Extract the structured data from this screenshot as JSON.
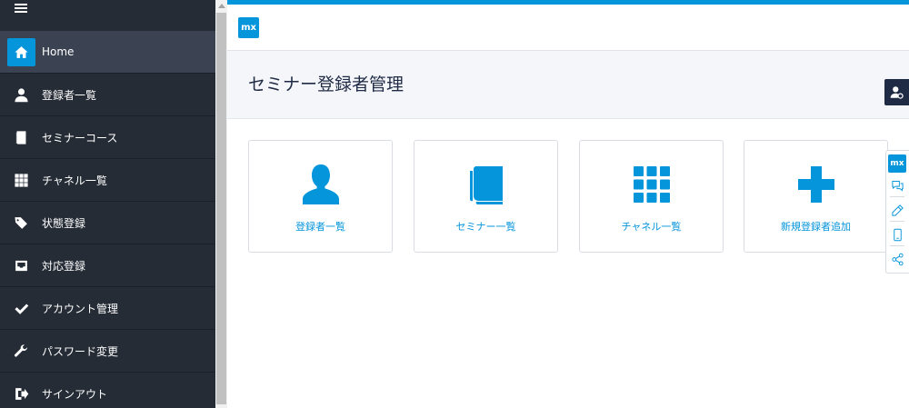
{
  "sidebar": {
    "items": [
      {
        "label": "Home",
        "icon": "home-icon"
      },
      {
        "label": "登録者一覧",
        "icon": "user-icon"
      },
      {
        "label": "セミナーコース",
        "icon": "book-icon"
      },
      {
        "label": "チャネル一覧",
        "icon": "grid-icon"
      },
      {
        "label": "状態登録",
        "icon": "tags-icon"
      },
      {
        "label": "対応登録",
        "icon": "inbox-icon"
      },
      {
        "label": "アカウント管理",
        "icon": "check-icon"
      },
      {
        "label": "パスワード変更",
        "icon": "wrench-icon"
      },
      {
        "label": "サインアウト",
        "icon": "sign-out-icon"
      }
    ]
  },
  "topbar": {
    "logo_text": "mx"
  },
  "page": {
    "title": "セミナー登録者管理"
  },
  "tiles": [
    {
      "label": "登録者一覧",
      "icon": "user-icon"
    },
    {
      "label": "セミナー一覧",
      "icon": "book-icon"
    },
    {
      "label": "チャネル一覧",
      "icon": "grid-icon"
    },
    {
      "label": "新規登録者追加",
      "icon": "plus-icon"
    }
  ],
  "tools": {
    "logo_text": "mx"
  },
  "colors": {
    "accent": "#0595db",
    "sidebar": "#252c36",
    "sidebar_active": "#3b4251",
    "navy": "#1f2a44"
  }
}
